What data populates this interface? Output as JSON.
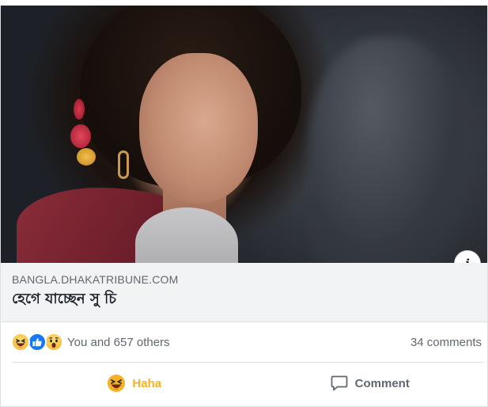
{
  "link_preview": {
    "domain": "BANGLA.DHAKATRIBUNE.COM",
    "headline": "হেগে যাচ্ছেন সু চি",
    "info_icon": "info-icon"
  },
  "engagement": {
    "reaction_icons": [
      "haha-reaction-icon",
      "like-reaction-icon",
      "wow-reaction-icon"
    ],
    "reaction_summary": "You and 657 others",
    "comments_label": "34 comments"
  },
  "actions": {
    "reaction_label": "Haha",
    "comment_label": "Comment"
  },
  "colors": {
    "haha_active": "#f7b125",
    "like_blue": "#1877f2",
    "meta_background": "#f2f3f5",
    "secondary_text": "#606770"
  }
}
